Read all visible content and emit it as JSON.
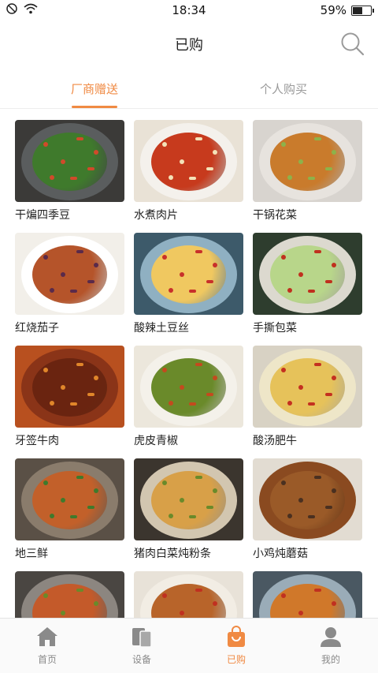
{
  "status_bar": {
    "time": "18:34",
    "battery": "59%",
    "battery_level": 0.59
  },
  "header": {
    "title": "已购"
  },
  "tabs": [
    {
      "label": "厂商赠送",
      "active": true
    },
    {
      "label": "个人购买",
      "active": false
    }
  ],
  "dishes": [
    {
      "name": "干煸四季豆",
      "bg": "#3b3a38",
      "plate": "#5a5d5e",
      "food": "#3f7a2c",
      "accent": "#d14a2a"
    },
    {
      "name": "水煮肉片",
      "bg": "#e9e2d6",
      "plate": "#f4f1ec",
      "food": "#c73a1d",
      "accent": "#f4e2b8"
    },
    {
      "name": "干锅花菜",
      "bg": "#d8d4cf",
      "plate": "#e7e3de",
      "food": "#c97b2c",
      "accent": "#8db24a"
    },
    {
      "name": "红烧茄子",
      "bg": "#f2efe9",
      "plate": "#ffffff",
      "food": "#b5542a",
      "accent": "#5a2a4a"
    },
    {
      "name": "酸辣土豆丝",
      "bg": "#3d5a6a",
      "plate": "#8fb0c2",
      "food": "#f0c860",
      "accent": "#c8302a"
    },
    {
      "name": "手撕包菜",
      "bg": "#2e3d2e",
      "plate": "#dcd9cf",
      "food": "#b8d68a",
      "accent": "#c0301e"
    },
    {
      "name": "牙签牛肉",
      "bg": "#b8501f",
      "plate": "#8a3418",
      "food": "#6a2410",
      "accent": "#e0862a"
    },
    {
      "name": "虎皮青椒",
      "bg": "#ece7dc",
      "plate": "#f4f1ea",
      "food": "#6a8a2a",
      "accent": "#c44a1e"
    },
    {
      "name": "酸汤肥牛",
      "bg": "#d8d2c4",
      "plate": "#eee6c8",
      "food": "#e6c25a",
      "accent": "#c43020"
    },
    {
      "name": "地三鲜",
      "bg": "#5a5046",
      "plate": "#8a7c6c",
      "food": "#c2602a",
      "accent": "#3f7a2c"
    },
    {
      "name": "猪肉白菜炖粉条",
      "bg": "#3b352e",
      "plate": "#d2c6b0",
      "food": "#d8a048",
      "accent": "#6a8a2a"
    },
    {
      "name": "小鸡炖蘑菇",
      "bg": "#e2dcd2",
      "plate": "#8a4a20",
      "food": "#9a5a28",
      "accent": "#4a3020"
    },
    {
      "name": "",
      "bg": "#4a4642",
      "plate": "#8c8680",
      "food": "#c45a2a",
      "accent": "#6a8a2a"
    },
    {
      "name": "",
      "bg": "#e8e2d8",
      "plate": "#f2ede4",
      "food": "#b8642a",
      "accent": "#c03020"
    },
    {
      "name": "",
      "bg": "#4a5862",
      "plate": "#9aacb8",
      "food": "#d0782a",
      "accent": "#c03020"
    }
  ],
  "bottom_nav": [
    {
      "label": "首页",
      "icon": "home-icon",
      "active": false
    },
    {
      "label": "设备",
      "icon": "devices-icon",
      "active": false
    },
    {
      "label": "已购",
      "icon": "shopping-bag-icon",
      "active": true
    },
    {
      "label": "我的",
      "icon": "user-icon",
      "active": false
    }
  ],
  "colors": {
    "accent": "#f08a43",
    "inactive": "#8a8a8a"
  }
}
